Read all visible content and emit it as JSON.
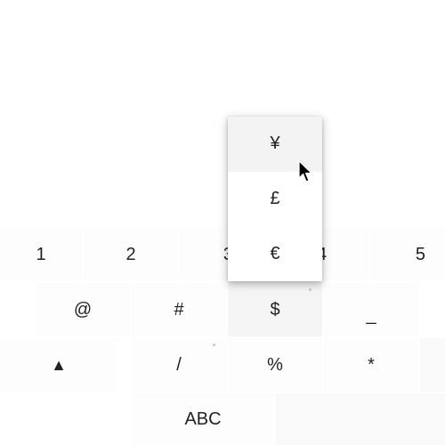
{
  "keyboard": {
    "number_row": [
      "1",
      "2",
      "3",
      "4",
      "5"
    ],
    "symbol_row": [
      "@",
      "#",
      "$",
      "_"
    ],
    "symbol_row2": [
      "▲",
      "/",
      "%",
      "*"
    ],
    "bottom_row": {
      "abc_label": "ABC"
    }
  },
  "popup": {
    "items": [
      "¥",
      "£",
      "€"
    ],
    "selected_index": 0
  },
  "cursor": {
    "icon": "arrow-pointer-icon"
  }
}
